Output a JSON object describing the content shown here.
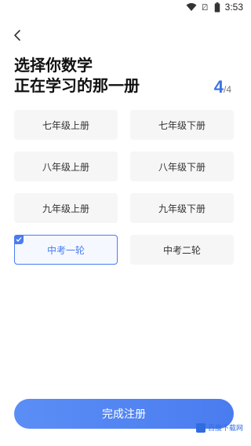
{
  "status_bar": {
    "time": "3:53"
  },
  "title": {
    "line1": "选择你数学",
    "line2": "正在学习的那一册"
  },
  "step": {
    "current": "4",
    "total": "/4"
  },
  "grades": [
    {
      "label": "七年级上册",
      "selected": false
    },
    {
      "label": "七年级下册",
      "selected": false
    },
    {
      "label": "八年级上册",
      "selected": false
    },
    {
      "label": "八年级下册",
      "selected": false
    },
    {
      "label": "九年级上册",
      "selected": false
    },
    {
      "label": "九年级下册",
      "selected": false
    },
    {
      "label": "中考一轮",
      "selected": true
    },
    {
      "label": "中考二轮",
      "selected": false
    }
  ],
  "complete_button": {
    "label": "完成注册"
  },
  "watermark": {
    "text": "百度下载网"
  },
  "colors": {
    "accent": "#4a7cf0",
    "step_color": "#3b73e6",
    "button_bg": "#f6f6f6"
  },
  "icons": [
    "wifi-icon",
    "sim-icon",
    "battery-icon",
    "back-chevron-icon",
    "check-icon"
  ]
}
